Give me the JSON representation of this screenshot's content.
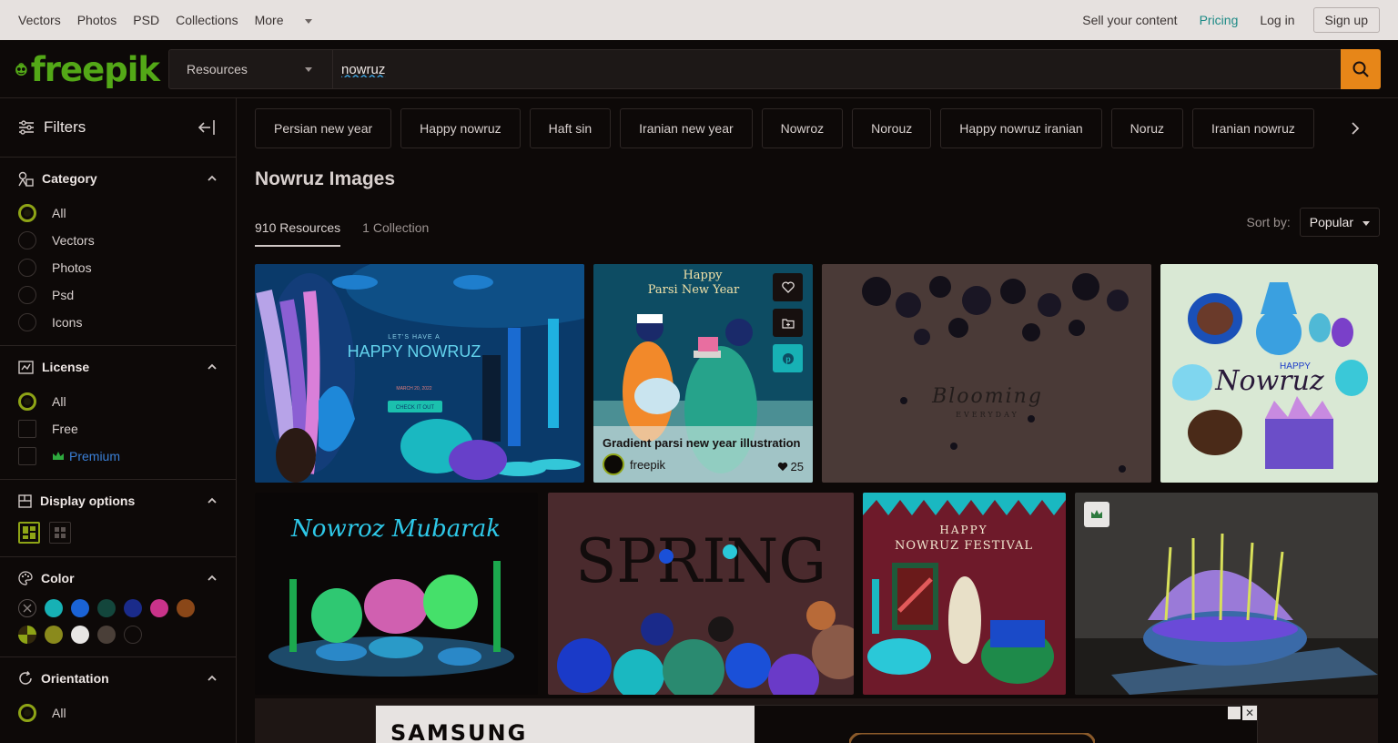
{
  "topnav": {
    "vectors": "Vectors",
    "photos": "Photos",
    "psd": "PSD",
    "collections": "Collections",
    "more": "More",
    "sell": "Sell your content",
    "pricing": "Pricing",
    "login": "Log in",
    "signup": "Sign up"
  },
  "header": {
    "logo": "freepik",
    "resource_select": "Resources",
    "search_value": "nowruz"
  },
  "sidebar": {
    "title": "Filters",
    "category": {
      "title": "Category",
      "options": [
        "All",
        "Vectors",
        "Photos",
        "Psd",
        "Icons"
      ],
      "selected": "All"
    },
    "license": {
      "title": "License",
      "options": [
        "All",
        "Free",
        "Premium"
      ],
      "selected": "All"
    },
    "display": {
      "title": "Display options"
    },
    "color": {
      "title": "Color",
      "swatches": [
        "none",
        "#17b1b5",
        "#1a63d6",
        "#13463c",
        "#1a2b8a",
        "#c9338a",
        "#8a4718",
        "#8ea416",
        "#8a8a1c",
        "#e8e6e4",
        "#4a3f38",
        "#0d0908"
      ]
    },
    "orientation": {
      "title": "Orientation",
      "options": [
        "All"
      ],
      "selected": "All"
    }
  },
  "main": {
    "tags": [
      "Persian new year",
      "Happy nowruz",
      "Haft sin",
      "Iranian new year",
      "Nowroz",
      "Norouz",
      "Happy nowruz iranian",
      "Noruz",
      "Iranian nowruz"
    ],
    "title": "Nowruz Images",
    "tabs": [
      "910 Resources",
      "1 Collection"
    ],
    "sort_label": "Sort by:",
    "sort_value": "Popular",
    "cards": [
      {
        "text1": "LET'S HAVE A",
        "text2": "HAPPY NOWRUZ",
        "button": "CHECK IT OUT",
        "date": "MARCH 20, 2022"
      },
      {
        "text1": "Happy",
        "text2": "Parsi New Year",
        "title": "Gradient parsi new year illustration",
        "author": "freepik",
        "likes": "25"
      },
      {
        "text1": "Blooming",
        "text2": "EVERYDAY"
      },
      {
        "text1": "HAPPY",
        "text2": "Nowruz"
      },
      {
        "text1": "Nowroz Mubarak"
      },
      {
        "text1": "SPRING"
      },
      {
        "text1": "HAPPY",
        "text2": "NOWRUZ FESTIVAL"
      },
      {
        "text1": ""
      }
    ],
    "ad_brand": "SAMSUNG"
  }
}
